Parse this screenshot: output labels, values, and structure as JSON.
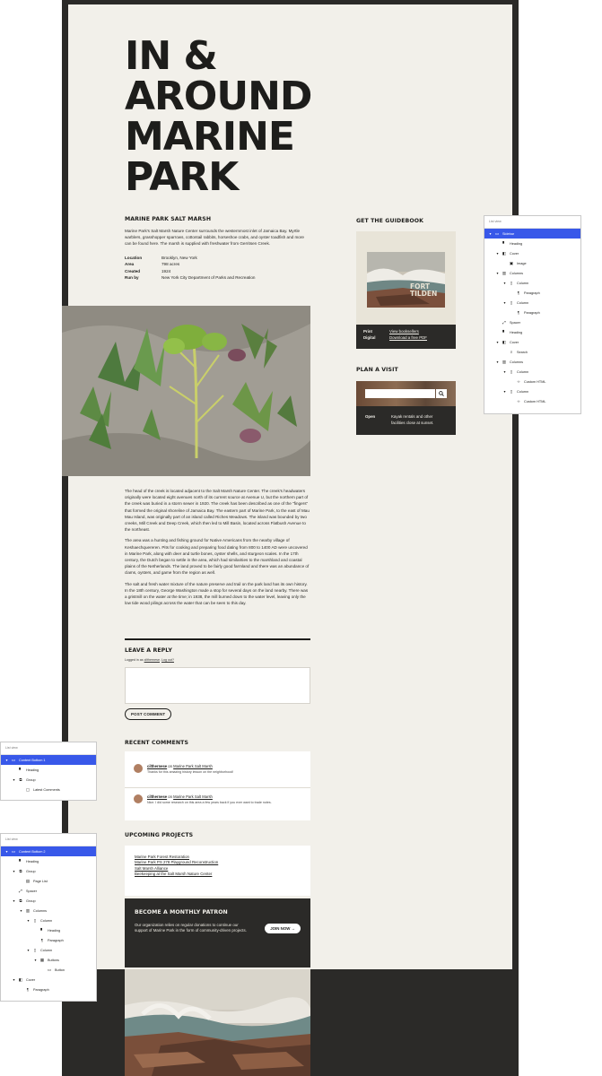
{
  "page": {
    "title_lines": [
      "IN &",
      "AROUND",
      "MARINE",
      "PARK"
    ]
  },
  "intro": {
    "heading": "MARINE PARK SALT MARSH",
    "paragraph": "Marine Park's Salt Marsh Nature Center surrounds the westernmost inlet of Jamaica Bay. Myrtle warblers, grasshopper sparrows, cottontail rabbits, horseshoe crabs, and oyster toadfish and more can be found here. The marsh is supplied with freshwater from Gerritsen Creek.",
    "facts": [
      {
        "key": "Location",
        "value": "Brooklyn, New York"
      },
      {
        "key": "Area",
        "value": "798 acres"
      },
      {
        "key": "Created",
        "value": "1924"
      },
      {
        "key": "Run by",
        "value": "New York City Department of Parks and Recreation"
      }
    ]
  },
  "article": {
    "paragraphs": [
      "The head of the creek is located adjacent to the Salt Marsh Nature Center. The creek's headwaters originally were located eight avenues north of its current source at Avenue U, but the northern part of the creek was buried in a storm sewer in 1920. The creek has been described as one of the \"fingers\" that formed the original shoreline of Jamaica Bay. The eastern part of Marine Park, to the east of Mau Mau Island, was originally part of an island called Riches Meadows. The island was bounded by two creeks, Mill Creek and Deep Creek, which then led to Mill Basin, located across Flatbush Avenue to the northeast.",
      "The area was a hunting and fishing ground for Native Americans from the nearby village of Keshaechquereren. Pits for cooking and preparing food dating from 800 to 1400 AD were uncovered in Marine Park, along with deer and turtle bones, oyster shells, and sturgeon scales. In the 17th century, the Dutch began to settle in the area, which had similarities to the marshland and coastal plains of the Netherlands. The land proved to be fairly good farmland and there was an abundance of clams, oysters, and game from the region as well.",
      "The salt and fresh water mixture of the nature preserve and trail on the park land has its own history. In the 18th century, George Washington made a stop for several days on the land nearby. There was a gristmill on the water at the time; in 1938, the mill burned down to the water level, leaving only the low tide wood pilings across the water that can be seen to this day."
    ]
  },
  "reply": {
    "heading": "LEAVE A REPLY",
    "logged_prefix": "Logged in as",
    "user": "cilthernese",
    "logout": "Log out?",
    "button": "POST COMMENT"
  },
  "recent_comments": {
    "heading": "RECENT COMMENTS",
    "items": [
      {
        "author": "cilthernese",
        "on": "on",
        "post": "Marine Park Salt Marsh",
        "text": "Thanks for this amazing history lesson on the neighborhood!"
      },
      {
        "author": "cilthernese",
        "on": "on",
        "post": "Marine Park Salt Marsh",
        "text": "Nice. I did some research on this area a few years back if you ever want to trade notes."
      }
    ]
  },
  "projects": {
    "heading": "UPCOMING PROJECTS",
    "items": [
      "Marine Park Forest Restoration",
      "Marine Park PS 278 Playground Reconstruction",
      "Salt Marsh Alliance",
      "Beekeeping at the Salt Marsh Nature Center"
    ]
  },
  "patron": {
    "heading": "BECOME A MONTHLY PATRON",
    "text": "Our organization relies on regular donations to continue our support of Marine Park in the form of community-driven projects.",
    "button": "JOIN NOW →"
  },
  "guidebook": {
    "heading": "GET THE GUIDEBOOK",
    "cover_text": [
      "FORT",
      "TILDEN"
    ],
    "rows": [
      {
        "key": "Print",
        "value": "View booksellers"
      },
      {
        "key": "Digital",
        "value": "Download a free PDF"
      }
    ]
  },
  "visit": {
    "heading": "PLAN A VISIT",
    "search_placeholder": "",
    "open_key": "Open",
    "open_text": "Kayak rentals and other facilities close at sunset."
  },
  "list_views": {
    "sidebar": {
      "title": "List view",
      "rows": [
        {
          "label": "Sidebar",
          "depth": 0,
          "chev": "▾",
          "icon": "template-part-icon",
          "glyph": "▭",
          "selected": true
        },
        {
          "label": "Heading",
          "depth": 1,
          "chev": "",
          "icon": "heading-icon",
          "glyph": "▘",
          "selected": false
        },
        {
          "label": "Cover",
          "depth": 1,
          "chev": "▾",
          "icon": "cover-icon",
          "glyph": "◧",
          "selected": false
        },
        {
          "label": "Image",
          "depth": 2,
          "chev": "",
          "icon": "image-icon",
          "glyph": "▣",
          "selected": false
        },
        {
          "label": "Columns",
          "depth": 1,
          "chev": "▾",
          "icon": "columns-icon",
          "glyph": "▥",
          "selected": false
        },
        {
          "label": "Column",
          "depth": 2,
          "chev": "▾",
          "icon": "column-icon",
          "glyph": "▯",
          "selected": false
        },
        {
          "label": "Paragraph",
          "depth": 3,
          "chev": "",
          "icon": "paragraph-icon",
          "glyph": "¶",
          "selected": false
        },
        {
          "label": "Column",
          "depth": 2,
          "chev": "▾",
          "icon": "column-icon",
          "glyph": "▯",
          "selected": false
        },
        {
          "label": "Paragraph",
          "depth": 3,
          "chev": "",
          "icon": "paragraph-icon",
          "glyph": "¶",
          "selected": false
        },
        {
          "label": "Spacer",
          "depth": 1,
          "chev": "",
          "icon": "spacer-icon",
          "glyph": "⤢",
          "selected": false
        },
        {
          "label": "Heading",
          "depth": 1,
          "chev": "",
          "icon": "heading-icon",
          "glyph": "▘",
          "selected": false
        },
        {
          "label": "Cover",
          "depth": 1,
          "chev": "▾",
          "icon": "cover-icon",
          "glyph": "◧",
          "selected": false
        },
        {
          "label": "Search",
          "depth": 2,
          "chev": "",
          "icon": "search-icon",
          "glyph": "⌕",
          "selected": false
        },
        {
          "label": "Columns",
          "depth": 1,
          "chev": "▾",
          "icon": "columns-icon",
          "glyph": "▥",
          "selected": false
        },
        {
          "label": "Column",
          "depth": 2,
          "chev": "▾",
          "icon": "column-icon",
          "glyph": "▯",
          "selected": false
        },
        {
          "label": "Custom HTML",
          "depth": 3,
          "chev": "",
          "icon": "html-icon",
          "glyph": "‹›",
          "selected": false
        },
        {
          "label": "Column",
          "depth": 2,
          "chev": "▾",
          "icon": "column-icon",
          "glyph": "▯",
          "selected": false
        },
        {
          "label": "Custom HTML",
          "depth": 3,
          "chev": "",
          "icon": "html-icon",
          "glyph": "‹›",
          "selected": false
        }
      ]
    },
    "content_bottom_1": {
      "title": "List view",
      "rows": [
        {
          "label": "Content Bottom 1",
          "depth": 0,
          "chev": "▾",
          "icon": "template-part-icon",
          "glyph": "▭",
          "selected": true
        },
        {
          "label": "Heading",
          "depth": 1,
          "chev": "",
          "icon": "heading-icon",
          "glyph": "▘",
          "selected": false
        },
        {
          "label": "Group",
          "depth": 1,
          "chev": "▾",
          "icon": "group-icon",
          "glyph": "⧉",
          "selected": false
        },
        {
          "label": "Latest Comments",
          "depth": 2,
          "chev": "",
          "icon": "comments-icon",
          "glyph": "▢",
          "selected": false
        }
      ]
    },
    "content_bottom_2": {
      "title": "List view",
      "rows": [
        {
          "label": "Content Bottom 2",
          "depth": 0,
          "chev": "▾",
          "icon": "template-part-icon",
          "glyph": "▭",
          "selected": true
        },
        {
          "label": "Heading",
          "depth": 1,
          "chev": "",
          "icon": "heading-icon",
          "glyph": "▘",
          "selected": false
        },
        {
          "label": "Group",
          "depth": 1,
          "chev": "▾",
          "icon": "group-icon",
          "glyph": "⧉",
          "selected": false
        },
        {
          "label": "Page List",
          "depth": 2,
          "chev": "",
          "icon": "page-list-icon",
          "glyph": "▤",
          "selected": false
        },
        {
          "label": "Spacer",
          "depth": 1,
          "chev": "",
          "icon": "spacer-icon",
          "glyph": "⤢",
          "selected": false
        },
        {
          "label": "Group",
          "depth": 1,
          "chev": "▾",
          "icon": "group-icon",
          "glyph": "⧉",
          "selected": false
        },
        {
          "label": "Columns",
          "depth": 2,
          "chev": "▾",
          "icon": "columns-icon",
          "glyph": "▥",
          "selected": false
        },
        {
          "label": "Column",
          "depth": 3,
          "chev": "▾",
          "icon": "column-icon",
          "glyph": "▯",
          "selected": false
        },
        {
          "label": "Heading",
          "depth": 4,
          "chev": "",
          "icon": "heading-icon",
          "glyph": "▘",
          "selected": false
        },
        {
          "label": "Paragraph",
          "depth": 4,
          "chev": "",
          "icon": "paragraph-icon",
          "glyph": "¶",
          "selected": false
        },
        {
          "label": "Column",
          "depth": 3,
          "chev": "▾",
          "icon": "column-icon",
          "glyph": "▯",
          "selected": false
        },
        {
          "label": "Buttons",
          "depth": 4,
          "chev": "▾",
          "icon": "buttons-icon",
          "glyph": "▦",
          "selected": false
        },
        {
          "label": "Button",
          "depth": 5,
          "chev": "",
          "icon": "button-icon",
          "glyph": "▭",
          "selected": false
        },
        {
          "label": "Cover",
          "depth": 1,
          "chev": "▾",
          "icon": "cover-icon",
          "glyph": "◧",
          "selected": false
        },
        {
          "label": "Paragraph",
          "depth": 2,
          "chev": "",
          "icon": "paragraph-icon",
          "glyph": "¶",
          "selected": false
        }
      ]
    }
  },
  "colors": {
    "paper": "#f2f0ea",
    "ink": "#1d1d1b",
    "dark": "#2b2a28",
    "selection": "#3858e9"
  }
}
